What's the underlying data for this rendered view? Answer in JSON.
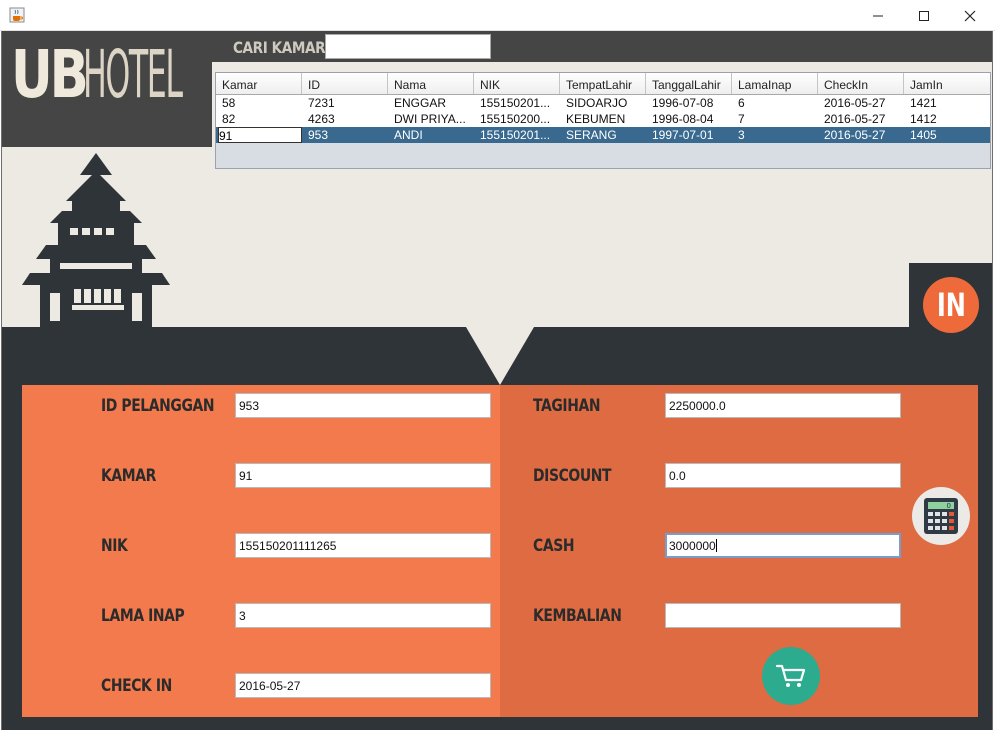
{
  "window": {
    "app_icon": "java-cup-icon"
  },
  "header": {
    "logo_ub": "UB",
    "logo_hotel": "HOTEL",
    "search_label": "CARI KAMAR",
    "search_value": ""
  },
  "table": {
    "columns": [
      "Kamar",
      "ID",
      "Nama",
      "NIK",
      "TempatLahir",
      "TanggalLahir",
      "LamaInap",
      "CheckIn",
      "JamIn"
    ],
    "rows": [
      [
        "58",
        "7231",
        "ENGGAR",
        "155150201...",
        "SIDOARJO",
        "1996-07-08",
        "6",
        "2016-05-27",
        "1421"
      ],
      [
        "82",
        "4263",
        "DWI PRIYA...",
        "155150200...",
        "KEBUMEN",
        "1996-08-04",
        "7",
        "2016-05-27",
        "1412"
      ],
      [
        "91",
        "953",
        "ANDI",
        "155150201...",
        "SERANG",
        "1997-07-01",
        "3",
        "2016-05-27",
        "1405"
      ]
    ],
    "selected_row": 2
  },
  "badge": {
    "text": "IN"
  },
  "form": {
    "id_label": "ID PELANGGAN",
    "id_value": "953",
    "kamar_label": "KAMAR",
    "kamar_value": "91",
    "nik_label": "NIK",
    "nik_value": "155150201111265",
    "lama_label": "LAMA INAP",
    "lama_value": "3",
    "checkin_label": "CHECK IN",
    "checkin_value": "2016-05-27",
    "tagihan_label": "TAGIHAN",
    "tagihan_value": "2250000.0",
    "discount_label": "DISCOUNT",
    "discount_value": "0.0",
    "cash_label": "CASH",
    "cash_value": "3000000",
    "kembalian_label": "KEMBALIAN",
    "kembalian_value": ""
  },
  "buttons": {
    "calculator_display": "0"
  },
  "colors": {
    "header_dark": "#454545",
    "panel_left": "#f27a4c",
    "panel_right": "#df6b42",
    "badge_orange": "#ef6a3a",
    "cart_teal": "#2cab8e",
    "row_selected": "#39698f"
  }
}
